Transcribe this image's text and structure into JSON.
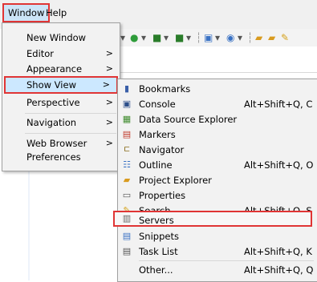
{
  "menubar": {
    "window": "Window",
    "help": "Help"
  },
  "window_menu": {
    "items": [
      {
        "label": "New Window",
        "has_sub": false
      },
      {
        "label": "Editor",
        "has_sub": true
      },
      {
        "label": "Appearance",
        "has_sub": true
      },
      {
        "label": "Show View",
        "has_sub": true
      },
      {
        "label": "Perspective",
        "has_sub": true
      },
      {
        "label": "Navigation",
        "has_sub": true
      },
      {
        "label": "Web Browser",
        "has_sub": true
      },
      {
        "label": "Preferences",
        "has_sub": false
      }
    ],
    "arrow": ">"
  },
  "show_view_menu": {
    "items": [
      {
        "label": "Bookmarks",
        "shortcut": "",
        "icon": "bookmarks-icon"
      },
      {
        "label": "Console",
        "shortcut": "Alt+Shift+Q, C",
        "icon": "console-icon"
      },
      {
        "label": "Data Source Explorer",
        "shortcut": "",
        "icon": "data-source-icon"
      },
      {
        "label": "Markers",
        "shortcut": "",
        "icon": "markers-icon"
      },
      {
        "label": "Navigator",
        "shortcut": "",
        "icon": "navigator-icon"
      },
      {
        "label": "Outline",
        "shortcut": "Alt+Shift+Q, O",
        "icon": "outline-icon"
      },
      {
        "label": "Project Explorer",
        "shortcut": "",
        "icon": "project-explorer-icon"
      },
      {
        "label": "Properties",
        "shortcut": "",
        "icon": "properties-icon"
      },
      {
        "label": "Search",
        "shortcut": "Alt+Shift+Q, S",
        "icon": "search-icon"
      },
      {
        "label": "Servers",
        "shortcut": "",
        "icon": "servers-icon"
      },
      {
        "label": "Snippets",
        "shortcut": "",
        "icon": "snippets-icon"
      },
      {
        "label": "Task List",
        "shortcut": "Alt+Shift+Q, K",
        "icon": "task-list-icon"
      },
      {
        "label": "Other...",
        "shortcut": "Alt+Shift+Q, Q",
        "icon": ""
      }
    ]
  }
}
